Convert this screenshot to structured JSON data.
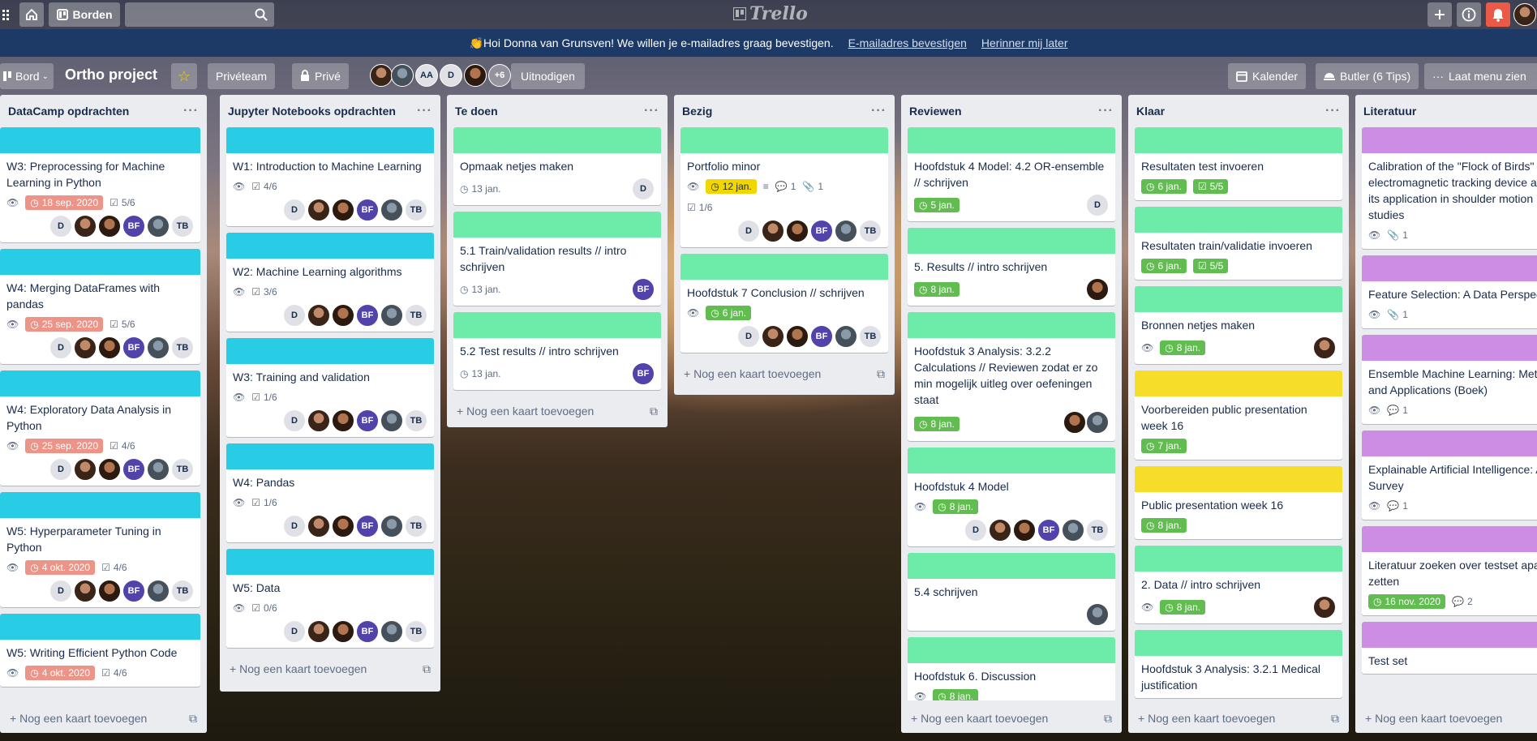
{
  "topbar": {
    "boards_label": "Borden",
    "logo": "Trello"
  },
  "banner": {
    "message": "👏Hoi Donna van Grunsven! We willen je e-mailadres graag bevestigen.",
    "confirm_link": "E-mailadres bevestigen",
    "remind_link": "Herinner mij later"
  },
  "boardbar": {
    "view_label": "Bord",
    "title": "Ortho project",
    "team": "Privéteam",
    "visibility": "Privé",
    "member_aa": "AA",
    "member_d": "D",
    "more_members": "+6",
    "invite": "Uitnodigen",
    "calendar": "Kalender",
    "butler": "Butler (6 Tips)",
    "menu": "Laat menu zien"
  },
  "add_card": "Nog een kaart toevoegen",
  "lists": [
    {
      "title": "DataCamp opdrachten",
      "cards": [
        {
          "title": "W3: Preprocessing for Machine Learning in Python",
          "due": "18 sep. 2020",
          "checklist": "5/6"
        },
        {
          "title": "W4: Merging DataFrames with pandas",
          "due": "25 sep. 2020",
          "checklist": "5/6"
        },
        {
          "title": "W4: Exploratory Data Analysis in Python",
          "due": "25 sep. 2020",
          "checklist": "4/6"
        },
        {
          "title": "W5: Hyperparameter Tuning in Python",
          "due": "4 okt. 2020",
          "checklist": "4/6"
        },
        {
          "title": "W5: Writing Efficient Python Code",
          "due": "4 okt. 2020",
          "checklist": "4/6"
        }
      ]
    },
    {
      "title": "Jupyter Notebooks opdrachten",
      "cards": [
        {
          "title": "W1: Introduction to Machine Learning",
          "checklist": "4/6"
        },
        {
          "title": "W2: Machine Learning algorithms",
          "checklist": "3/6"
        },
        {
          "title": "W3: Training and validation",
          "checklist": "1/6"
        },
        {
          "title": "W4: Pandas",
          "checklist": "1/6"
        },
        {
          "title": "W5: Data",
          "checklist": "0/6"
        }
      ]
    },
    {
      "title": "Te doen",
      "cards": [
        {
          "title": "Opmaak netjes maken",
          "due": "13 jan.",
          "member": "D"
        },
        {
          "title": "5.1 Train/validation results // intro schrijven",
          "due": "13 jan.",
          "member": "BF"
        },
        {
          "title": "5.2 Test results // intro schrijven",
          "due": "13 jan.",
          "member": "BF"
        }
      ]
    },
    {
      "title": "Bezig",
      "cards": [
        {
          "title": "Portfolio minor",
          "due": "12 jan.",
          "comments": "1",
          "attachments": "1",
          "checklist": "1/6"
        },
        {
          "title": "Hoofdstuk 7 Conclusion // schrijven",
          "due": "6 jan."
        }
      ]
    },
    {
      "title": "Reviewen",
      "cards": [
        {
          "title": "Hoofdstuk 4 Model: 4.2 OR-ensemble // schrijven",
          "due": "5 jan.",
          "member": "D"
        },
        {
          "title": "5. Results // intro schrijven",
          "due": "8 jan."
        },
        {
          "title": "Hoofdstuk 3 Analysis: 3.2.2 Calculations // Reviewen zodat er zo min mogelijk uitleg over oefeningen staat",
          "due": "8 jan."
        },
        {
          "title": "Hoofdstuk 4 Model",
          "due": "8 jan."
        },
        {
          "title": "5.4 schrijven"
        },
        {
          "title": "Hoofdstuk 6. Discussion",
          "due": "8 jan."
        }
      ]
    },
    {
      "title": "Klaar",
      "cards": [
        {
          "title": "Resultaten test invoeren",
          "due": "6 jan.",
          "checklist": "5/5"
        },
        {
          "title": "Resultaten train/validatie invoeren",
          "due": "6 jan.",
          "checklist": "5/5"
        },
        {
          "title": "Bronnen netjes maken",
          "due": "8 jan."
        },
        {
          "title": "Voorbereiden public presentation week 16",
          "due": "7 jan."
        },
        {
          "title": "Public presentation week 16",
          "due": "8 jan."
        },
        {
          "title": "2. Data // intro schrijven",
          "due": "8 jan."
        },
        {
          "title": "Hoofdstuk 3 Analysis: 3.2.1 Medical justification"
        }
      ]
    },
    {
      "title": "Literatuur",
      "cards": [
        {
          "title": "Calibration of the \"Flock of Birds\" electromagnetic tracking device and its application in shoulder motion studies",
          "attachments": "1"
        },
        {
          "title": "Feature Selection: A Data Perspective",
          "attachments": "1"
        },
        {
          "title": "Ensemble Machine Learning: Methods and Applications (Boek)",
          "comments": "1"
        },
        {
          "title": "Explainable Artificial Intelligence: A Survey",
          "comments": "1"
        },
        {
          "title": "Literatuur zoeken over testset apart zetten",
          "due": "16 nov. 2020",
          "comments": "2"
        },
        {
          "title": "Test set"
        }
      ]
    }
  ],
  "members": {
    "d": "D",
    "bf": "BF",
    "tb": "TB"
  }
}
